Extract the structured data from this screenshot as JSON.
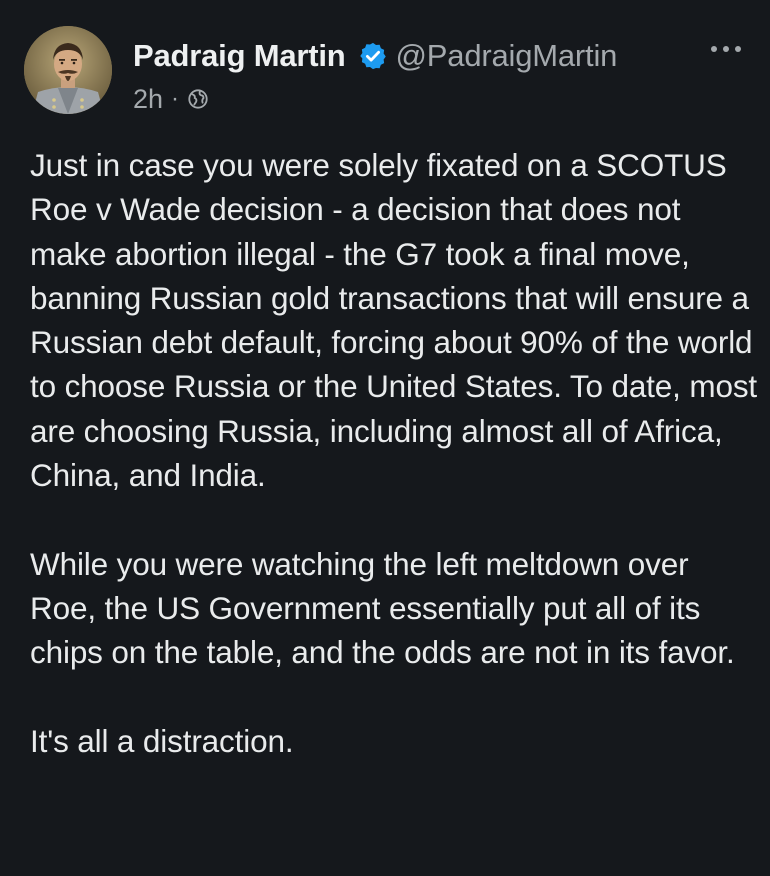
{
  "post": {
    "author": {
      "display_name": "Padraig Martin",
      "handle": "@PadraigMartin",
      "verified": true,
      "avatar": "portrait-of-man-in-grey-uniform"
    },
    "timestamp": "2h",
    "separator": "·",
    "audience_icon": "globe-icon",
    "menu_icon": "more-options-icon",
    "paragraphs": [
      "Just in case you were solely fixated on a SCOTUS Roe v Wade decision - a decision that does not make abortion illegal - the G7 took a final move, banning Russian gold transactions that will ensure a Russian debt default, forcing about 90% of the world to choose Russia or the United States. To date, most are choosing Russia, including almost all of Africa, China, and India.",
      "While you were watching the left meltdown over Roe, the US Government essentially put all of its chips on the table, and the odds are not in its favor.",
      "It's all a distraction."
    ]
  },
  "colors": {
    "background": "#15181c",
    "text": "#e9ebec",
    "secondary_text": "#a4a9ad",
    "verified_badge": "#1d9bf0"
  }
}
